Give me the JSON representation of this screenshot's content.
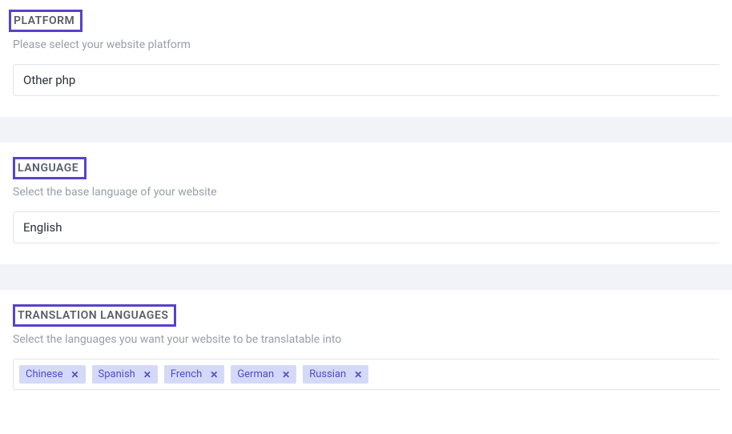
{
  "platform": {
    "title": "PLATFORM",
    "desc": "Please select your website platform",
    "value": "Other php"
  },
  "language": {
    "title": "LANGUAGE",
    "desc": "Select the base language of your website",
    "value": "English"
  },
  "translation": {
    "title": "TRANSLATION LANGUAGES",
    "desc": "Select the languages you want your website to be translatable into",
    "tags": [
      "Chinese",
      "Spanish",
      "French",
      "German",
      "Russian"
    ]
  }
}
